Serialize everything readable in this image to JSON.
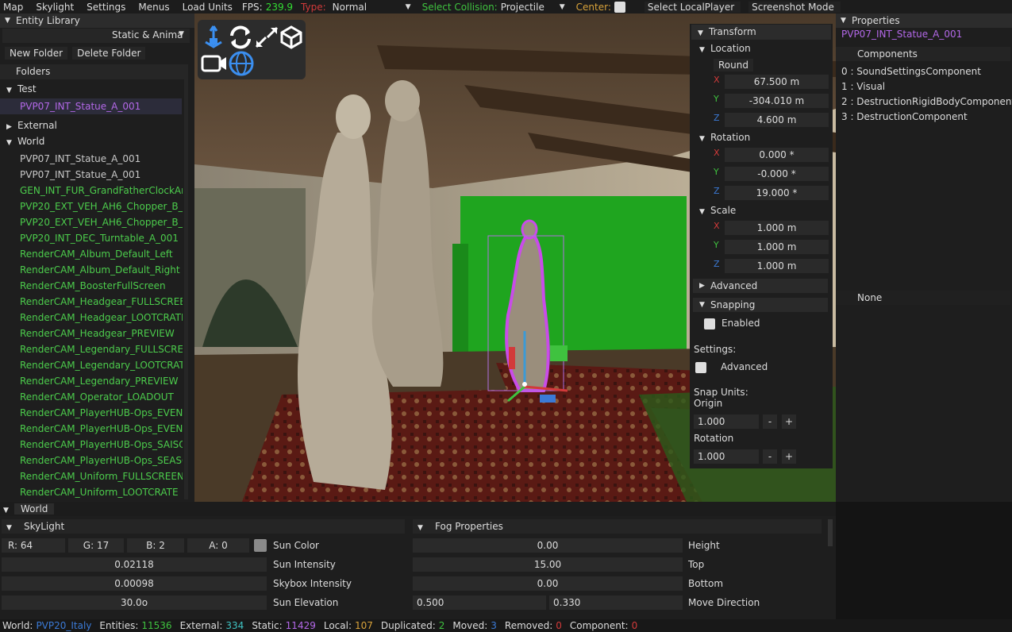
{
  "menubar": {
    "items": [
      "Map",
      "Skylight",
      "Settings",
      "Menus",
      "Load Units"
    ],
    "fps_label": "FPS:",
    "fps_value": "239.9",
    "type_label": "Type:",
    "type_value": "Normal",
    "collision_label": "Select Collision:",
    "collision_value": "Projectile",
    "center_label": "Center:",
    "select_local_player": "Select LocalPlayer",
    "screenshot_mode": "Screenshot Mode"
  },
  "entity_library": {
    "title": "Entity Library",
    "filter": "Static & Anima",
    "new_folder": "New Folder",
    "delete_folder": "Delete Folder",
    "folders_label": "Folders",
    "test_folder": "Test",
    "test_item": "PVP07_INT_Statue_A_001",
    "external_folder": "External",
    "world_folder": "World",
    "world_items": [
      {
        "label": "PVP07_INT_Statue_A_001",
        "color": "grey"
      },
      {
        "label": "PVP07_INT_Statue_A_001",
        "color": "grey"
      },
      {
        "label": "GEN_INT_FUR_GrandFatherClockAn",
        "color": "green"
      },
      {
        "label": "PVP20_EXT_VEH_AH6_Chopper_B_",
        "color": "green"
      },
      {
        "label": "PVP20_EXT_VEH_AH6_Chopper_B_",
        "color": "green"
      },
      {
        "label": "PVP20_INT_DEC_Turntable_A_001",
        "color": "green"
      },
      {
        "label": "RenderCAM_Album_Default_Left",
        "color": "green"
      },
      {
        "label": "RenderCAM_Album_Default_Right",
        "color": "green"
      },
      {
        "label": "RenderCAM_BoosterFullScreen",
        "color": "green"
      },
      {
        "label": "RenderCAM_Headgear_FULLSCREEN",
        "color": "green"
      },
      {
        "label": "RenderCAM_Headgear_LOOTCRATE",
        "color": "green"
      },
      {
        "label": "RenderCAM_Headgear_PREVIEW",
        "color": "green"
      },
      {
        "label": "RenderCAM_Legendary_FULLSCREE",
        "color": "green"
      },
      {
        "label": "RenderCAM_Legendary_LOOTCRAT",
        "color": "green"
      },
      {
        "label": "RenderCAM_Legendary_PREVIEW",
        "color": "green"
      },
      {
        "label": "RenderCAM_Operator_LOADOUT",
        "color": "green"
      },
      {
        "label": "RenderCAM_PlayerHUB-Ops_EVENT",
        "color": "green"
      },
      {
        "label": "RenderCAM_PlayerHUB-Ops_EVENT",
        "color": "green"
      },
      {
        "label": "RenderCAM_PlayerHUB-Ops_SAISO",
        "color": "green"
      },
      {
        "label": "RenderCAM_PlayerHUB-Ops_SEASC",
        "color": "green"
      },
      {
        "label": "RenderCAM_Uniform_FULLSCREEN",
        "color": "green"
      },
      {
        "label": "RenderCAM_Uniform_LOOTCRATE",
        "color": "green"
      }
    ]
  },
  "transform": {
    "title": "Transform",
    "location_label": "Location",
    "round_button": "Round",
    "location": {
      "x": "67.500 m",
      "y": "-304.010 m",
      "z": "4.600 m"
    },
    "rotation_label": "Rotation",
    "rotation": {
      "x": "0.000 *",
      "y": "-0.000 *",
      "z": "19.000 *"
    },
    "scale_label": "Scale",
    "scale": {
      "x": "1.000 m",
      "y": "1.000 m",
      "z": "1.000 m"
    },
    "axis_x": "X",
    "axis_y": "Y",
    "axis_z": "Z",
    "advanced_label": "Advanced",
    "snapping_label": "Snapping",
    "enabled_label": "Enabled",
    "settings_label": "Settings:",
    "settings_advanced": "Advanced",
    "snap_units_label": "Snap Units:",
    "origin_label": "Origin",
    "origin_value": "1.000",
    "snap_rotation_label": "Rotation",
    "snap_rotation_value": "1.000",
    "minus": "-",
    "plus": "+"
  },
  "properties": {
    "title": "Properties",
    "entity_name": "PVP07_INT_Statue_A_001",
    "components_label": "Components",
    "components": [
      "0 : SoundSettingsComponent",
      "1 : Visual",
      "2 : DestructionRigidBodyComponent",
      "3 : DestructionComponent"
    ],
    "none_label": "None"
  },
  "world_panel": {
    "title": "World",
    "skylight_label": "SkyLight",
    "fog_label": "Fog Properties",
    "r": "R: 64",
    "g": "G: 17",
    "b": "B:  2",
    "a": "A:  0",
    "sun_color": "Sun Color",
    "sun_intensity_value": "0.02118",
    "sun_intensity": "Sun Intensity",
    "skybox_value": "0.00098",
    "skybox": "Skybox Intensity",
    "sun_elevation_value": "30.0o",
    "sun_elevation": "Sun Elevation",
    "height_value": "0.00",
    "height": "Height",
    "top_value": "15.00",
    "top": "Top",
    "bottom_value": "0.00",
    "bottom": "Bottom",
    "move_dir_a": "0.500",
    "move_dir_b": "0.330",
    "move_direction": "Move Direction"
  },
  "status": {
    "world_label": "World:",
    "world_value": "PVP20_Italy",
    "entities_label": "Entities:",
    "entities_value": "11536",
    "external_label": "External:",
    "external_value": "334",
    "static_label": "Static:",
    "static_value": "11429",
    "local_label": "Local:",
    "local_value": "107",
    "duplicated_label": "Duplicated:",
    "duplicated_value": "2",
    "moved_label": "Moved:",
    "moved_value": "3",
    "removed_label": "Removed:",
    "removed_value": "0",
    "component_label": "Component:",
    "component_value": "0"
  },
  "colors": {
    "accent_green": "#33dd33",
    "accent_red": "#d23a3a",
    "accent_purple": "#b368e8",
    "axis_x": "#d23a3a",
    "axis_y": "#3fc23f",
    "axis_z": "#3b7ad6"
  }
}
